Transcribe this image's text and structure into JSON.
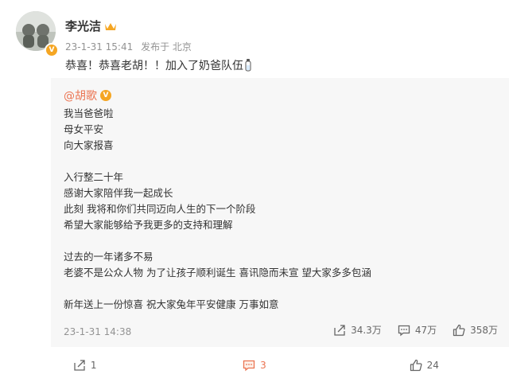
{
  "post": {
    "username": "李光洁",
    "time": "23-1-31 15:41",
    "source": "发布于 北京",
    "text": "恭喜！恭喜老胡！！加入了奶爸队伍"
  },
  "repost": {
    "author": "@胡歌",
    "lines": [
      "我当爸爸啦",
      "母女平安",
      "向大家报喜",
      "",
      "入行整二十年",
      "感谢大家陪伴我一起成长",
      "此刻 我将和你们共同迈向人生的下一个阶段",
      "希望大家能够给予我更多的支持和理解",
      "",
      "过去的一年诸多不易",
      "老婆不是公众人物 为了让孩子顺利诞生 喜讯隐而未宣 望大家多多包涵",
      "",
      "新年送上一份惊喜 祝大家兔年平安健康 万事如意"
    ],
    "time": "23-1-31 14:38",
    "share_count": "34.3万",
    "comment_count": "47万",
    "like_count": "358万"
  },
  "footer": {
    "share_count": "1",
    "comment_count": "3",
    "like_count": "24"
  },
  "colors": {
    "accent": "#eb7350",
    "badge": "#f5a623"
  },
  "icons": [
    "share-icon",
    "comment-icon",
    "like-icon",
    "crown-icon",
    "verified-badge-icon",
    "baby-bottle-icon"
  ]
}
